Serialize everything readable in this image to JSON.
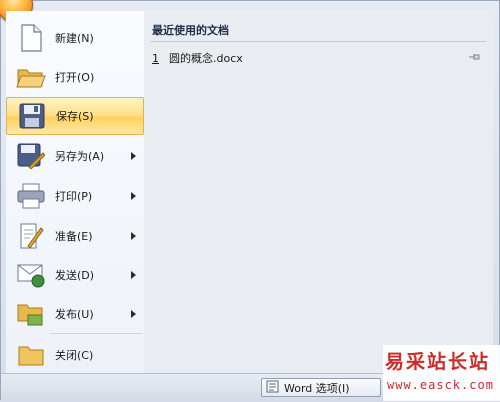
{
  "menu": {
    "items": [
      {
        "label": "新建(N)",
        "icon": "new-document-icon",
        "submenu": false
      },
      {
        "label": "打开(O)",
        "icon": "open-folder-icon",
        "submenu": false
      },
      {
        "label": "保存(S)",
        "icon": "save-disk-icon",
        "submenu": false,
        "selected": true
      },
      {
        "label": "另存为(A)",
        "icon": "save-as-icon",
        "submenu": true
      },
      {
        "label": "打印(P)",
        "icon": "printer-icon",
        "submenu": true
      },
      {
        "label": "准备(E)",
        "icon": "prepare-icon",
        "submenu": true
      },
      {
        "label": "发送(D)",
        "icon": "send-icon",
        "submenu": true
      },
      {
        "label": "发布(U)",
        "icon": "publish-icon",
        "submenu": true
      },
      {
        "label": "关闭(C)",
        "icon": "close-folder-icon",
        "submenu": false
      }
    ]
  },
  "recent": {
    "title": "最近使用的文档",
    "items": [
      {
        "number": "1",
        "name": "圆的概念.docx"
      }
    ]
  },
  "footer": {
    "word_options_label": "Word 选项(I)"
  },
  "watermark": {
    "cn": "易采站长站",
    "en": "www.easck.com"
  },
  "colors": {
    "selected_highlight": "#ffd25e",
    "watermark": "#cf2a2a",
    "menu_background": "#f9fbff"
  }
}
